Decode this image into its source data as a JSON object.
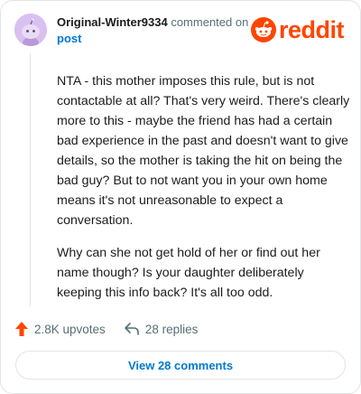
{
  "comment": {
    "username": "Original-Winter9334",
    "action": "commented on",
    "post_link": "post",
    "paragraphs": [
      "NTA - this mother imposes this rule, but is not contactable at all? That's very weird. There's clearly more to this - maybe the friend has had a certain bad experience in the past and doesn't want to give details, so the mother is taking the hit on being the bad guy? But to not want you in your own home means it's not unreasonable to expect a conversation.",
      "Why can she not get hold of her or find out her name though? Is your daughter deliberately keeping this info back? It's all too odd."
    ]
  },
  "brand": {
    "name": "reddit",
    "color": "#ff4500",
    "icon": "reddit-snoo-icon"
  },
  "stats": {
    "upvotes": "2.8K upvotes",
    "replies": "28 replies",
    "upvote_icon": "upvote-arrow-icon",
    "reply_icon": "reply-arrow-icon"
  },
  "view_comments_label": "View 28 comments",
  "colors": {
    "link": "#0079d3",
    "upvote": "#ff4500",
    "meta": "#576f76",
    "avatar_bg": "#d9c0f0"
  }
}
